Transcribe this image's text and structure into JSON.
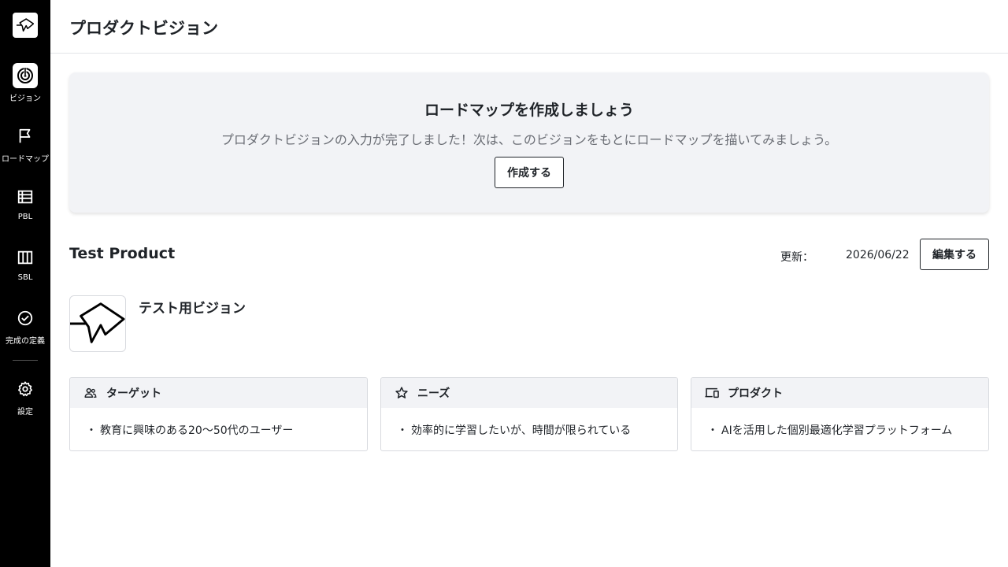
{
  "header": {
    "title": "プロダクトビジョン"
  },
  "sidebar": {
    "items": [
      {
        "label": "ビジョン",
        "icon": "vision-icon",
        "active": true
      },
      {
        "label": "ロードマップ",
        "icon": "flag-icon"
      },
      {
        "label": "PBL",
        "icon": "list-icon"
      },
      {
        "label": "SBL",
        "icon": "columns-icon"
      },
      {
        "label": "完成の定義",
        "icon": "check-circle-icon"
      },
      {
        "label": "設定",
        "icon": "gear-icon"
      }
    ]
  },
  "banner": {
    "title": "ロードマップを作成しましょう",
    "description": "プロダクトビジョンの入力が完了しました！次は、このビジョンをもとにロードマップを描いてみましょう。",
    "button_label": "作成する"
  },
  "product": {
    "name": "Test Product",
    "updated_label": "更新：",
    "updated_date": "2026/06/22",
    "edit_label": "編集する",
    "vision_text": "テスト用ビジョン"
  },
  "cards": [
    {
      "title": "ターゲット",
      "icon": "users-icon",
      "bullet": "・",
      "item": "教育に興味のある20〜50代のユーザー"
    },
    {
      "title": "ニーズ",
      "icon": "star-icon",
      "bullet": "・",
      "item": "効率的に学習したいが、時間が限られている"
    },
    {
      "title": "プロダクト",
      "icon": "devices-icon",
      "bullet": "・",
      "item": "AIを活用した個別最適化学習プラットフォーム"
    }
  ],
  "colors": {
    "sidebar_bg": "#000000",
    "panel_bg": "#f2f3f6",
    "border": "#d8dadf",
    "text": "#1f2328",
    "muted": "#6b6e75"
  }
}
